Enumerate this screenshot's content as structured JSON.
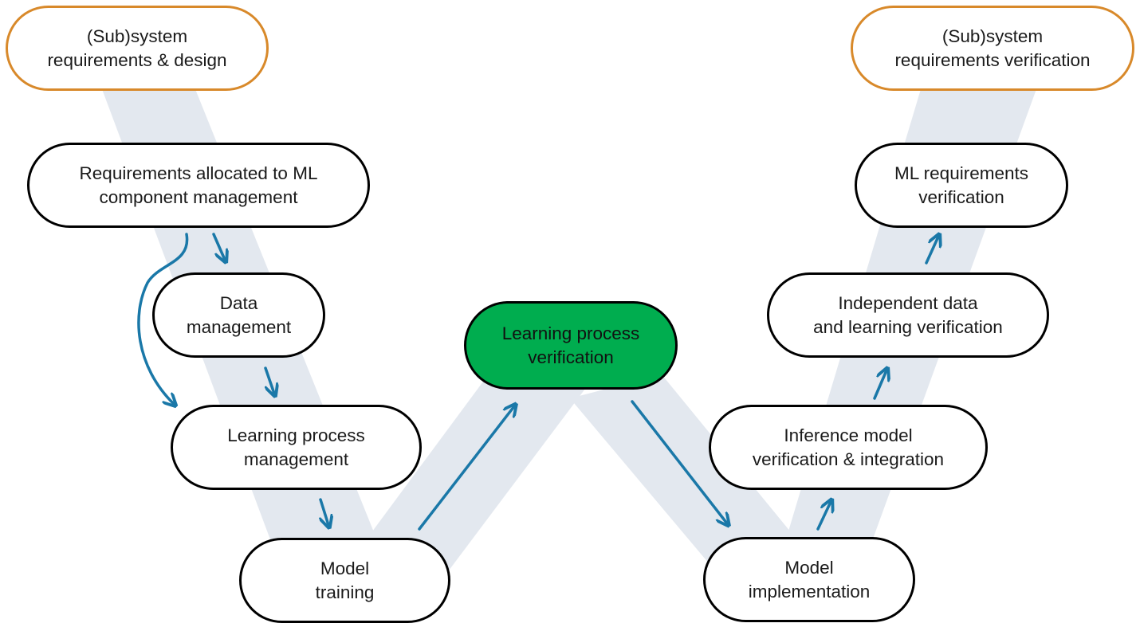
{
  "diagram": {
    "type": "W-shaped lifecycle process flow (ML assurance)",
    "colors": {
      "band": "#e3e8ef",
      "arrow": "#1a78a8",
      "system_border": "#d8892a",
      "node_border": "#000000",
      "highlight_fill": "#00ad4f"
    },
    "nodes": {
      "subsystem_design": {
        "lines": [
          "(Sub)system",
          "requirements & design"
        ]
      },
      "requirements_allocated": {
        "lines": [
          "Requirements allocated to ML",
          "component management"
        ]
      },
      "data_management": {
        "lines": [
          "Data",
          "management"
        ]
      },
      "learning_process_management": {
        "lines": [
          "Learning process",
          "management"
        ]
      },
      "model_training": {
        "lines": [
          "Model",
          "training"
        ]
      },
      "learning_process_verification": {
        "lines": [
          "Learning process",
          "verification"
        ]
      },
      "model_implementation": {
        "lines": [
          "Model",
          "implementation"
        ]
      },
      "inference_model_verification": {
        "lines": [
          "Inference model",
          "verification & integration"
        ]
      },
      "independent_verification": {
        "lines": [
          "Independent data",
          "and learning verification"
        ]
      },
      "ml_requirements_verification": {
        "lines": [
          "ML requirements",
          "verification"
        ]
      },
      "subsystem_verification": {
        "lines": [
          "(Sub)system",
          "requirements verification"
        ]
      }
    },
    "edges": [
      {
        "from": "requirements_allocated",
        "to": "data_management"
      },
      {
        "from": "requirements_allocated",
        "to": "learning_process_management",
        "curved": true
      },
      {
        "from": "data_management",
        "to": "learning_process_management"
      },
      {
        "from": "learning_process_management",
        "to": "model_training"
      },
      {
        "from": "model_training",
        "to": "learning_process_verification"
      },
      {
        "from": "learning_process_verification",
        "to": "model_implementation"
      },
      {
        "from": "model_implementation",
        "to": "inference_model_verification"
      },
      {
        "from": "inference_model_verification",
        "to": "independent_verification"
      },
      {
        "from": "independent_verification",
        "to": "ml_requirements_verification"
      }
    ]
  }
}
